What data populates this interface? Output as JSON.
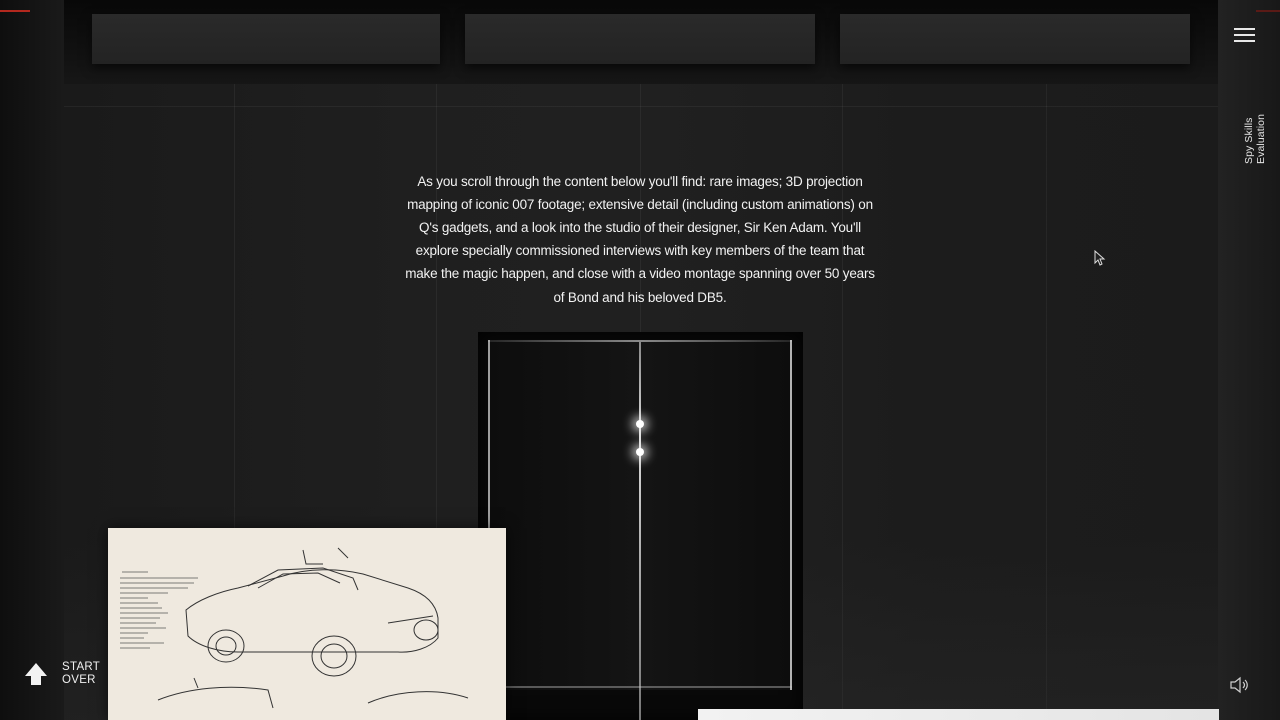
{
  "intro": {
    "text": "As you scroll through the content below you'll find: rare images; 3D projection mapping of iconic 007 footage; extensive detail (including custom animations) on Q's gadgets, and a look into the studio of their designer, Sir Ken Adam. You'll explore specially commissioned interviews with key members of the team that make the magic happen, and close with a video montage spanning over 50 years of Bond and his beloved DB5."
  },
  "nav": {
    "menu_icon": "hamburger-menu-icon",
    "side_label": "Spy Skills Evaluation"
  },
  "controls": {
    "start_over_line1": "START",
    "start_over_line2": "OVER",
    "start_over_icon": "up-arrow-icon",
    "sound_icon": "speaker-icon"
  },
  "colors": {
    "accent": "#b3281e",
    "background": "#141414",
    "text": "#f2f2f2",
    "sketch_paper": "#efe9df"
  }
}
